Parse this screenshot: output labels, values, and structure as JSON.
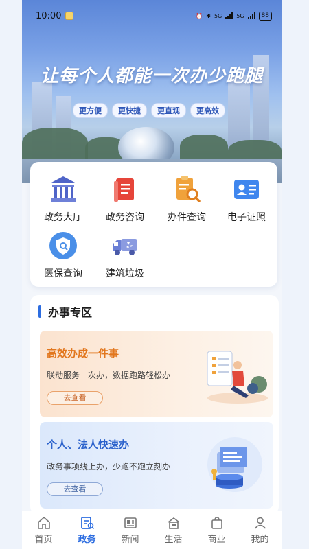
{
  "status": {
    "time": "10:00",
    "battery": "88",
    "network": [
      "5G",
      "5G"
    ]
  },
  "hero": {
    "slogan": "让每个人都能一次办少跑腿",
    "tags": [
      "更方便",
      "更快捷",
      "更直观",
      "更高效"
    ]
  },
  "services": [
    {
      "label": "政务大厅",
      "icon": "government-hall-icon",
      "color": "#4f64c8"
    },
    {
      "label": "政务咨询",
      "icon": "consult-book-icon",
      "color": "#e6453a"
    },
    {
      "label": "办件查询",
      "icon": "document-search-icon",
      "color": "#f0a23b"
    },
    {
      "label": "电子证照",
      "icon": "id-card-icon",
      "color": "#3f86ee"
    },
    {
      "label": "医保查询",
      "icon": "medical-shield-icon",
      "color": "#4a8fe8"
    },
    {
      "label": "建筑垃圾",
      "icon": "garbage-truck-icon",
      "color": "#6b7fd6"
    }
  ],
  "section": {
    "title": "办事专区",
    "cards": [
      {
        "title": "高效办成一件事",
        "subtitle": "联动服务一次办，数据跑路轻松办",
        "button": "去查看"
      },
      {
        "title": "个人、法人快速办",
        "subtitle": "政务事项线上办，少跑不跑立刻办",
        "button": "去查看"
      }
    ]
  },
  "tabbar": [
    {
      "label": "首页",
      "icon": "home-icon"
    },
    {
      "label": "政务",
      "icon": "government-affairs-icon",
      "active": true
    },
    {
      "label": "新闻",
      "icon": "news-icon"
    },
    {
      "label": "生活",
      "icon": "life-icon"
    },
    {
      "label": "商业",
      "icon": "shopping-bag-icon"
    },
    {
      "label": "我的",
      "icon": "user-icon"
    }
  ],
  "colors": {
    "accent": "#2d6de0",
    "orange": "#e2771e"
  }
}
